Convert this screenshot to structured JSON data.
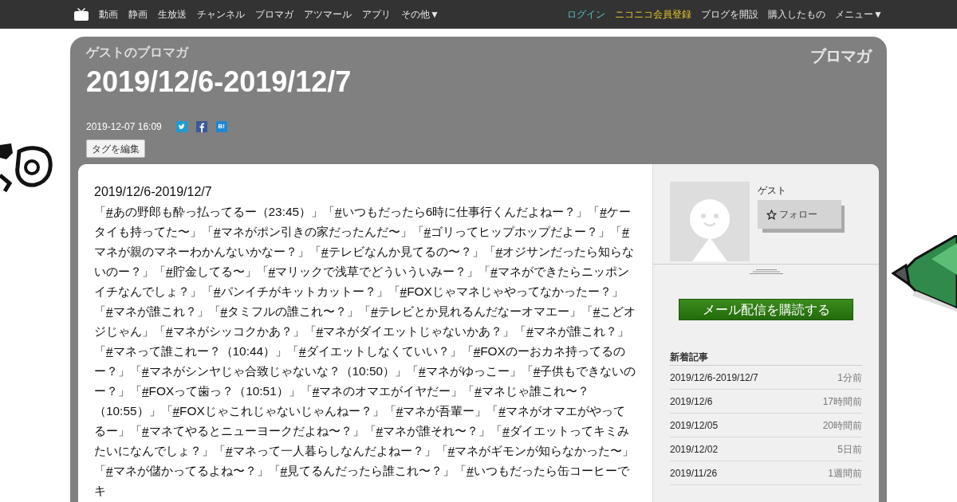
{
  "top_bar": {
    "nav": [
      "動画",
      "静画",
      "生放送",
      "チャンネル",
      "ブロマガ",
      "アツマール",
      "アプリ",
      "その他▼"
    ],
    "account": [
      {
        "label": "ログイン",
        "kind": "login"
      },
      {
        "label": "ニコニコ会員登録",
        "kind": "register"
      },
      {
        "label": "ブログを開設",
        "kind": "plain"
      },
      {
        "label": "購入したもの",
        "kind": "plain"
      },
      {
        "label": "メニュー▼",
        "kind": "plain"
      }
    ]
  },
  "header": {
    "blog_name": "ゲストのブロマガ",
    "logo": "ブロマガ",
    "title": "2019/12/6-2019/12/7",
    "date": "2019-12-07 16:09",
    "share": [
      {
        "kind": "twitter"
      },
      {
        "kind": "facebook"
      },
      {
        "kind": "hatena",
        "label": "B!"
      }
    ],
    "tag_button": "タグを編集"
  },
  "article": {
    "heading": "2019/12/6-2019/12/7",
    "tags": [
      {
        "open": "「",
        "link": "#",
        "rest": "あの野郎も酔っ払ってるー（23:45）」"
      },
      {
        "open": "「",
        "link": "#",
        "rest": "いつもだったら6時に仕事行くんだよねー？」"
      },
      {
        "open": "「",
        "link": "#",
        "rest": "ケータイも持ってた〜」"
      },
      {
        "open": "「",
        "link": "#",
        "rest": "マネがポン引きの家だったんだ〜」"
      },
      {
        "open": "「",
        "link": "#",
        "rest": "ゴリってヒップホップだよー？」"
      },
      {
        "open": "「",
        "link": "#",
        "rest": "マネが親のマネーわかんないかなー？」"
      },
      {
        "open": "「",
        "link": "#",
        "rest": "テレビなんか見てるの〜？」"
      },
      {
        "open": "「",
        "link": "#",
        "rest": "オジサンだったら知らないのー？」"
      },
      {
        "open": "「",
        "link": "#",
        "rest": "貯金してる〜」"
      },
      {
        "open": "「",
        "link": "#",
        "rest": "マリックで浅草でどういういみー？」"
      },
      {
        "open": "「",
        "link": "#",
        "rest": "マネができたらニッポンイチなんでしょ？」"
      },
      {
        "open": "「",
        "link": "#",
        "rest": "パンイチがキットカットー？」"
      },
      {
        "open": "「",
        "link": "#",
        "rest": "FOXじゃマネじゃやってなかったー？」"
      },
      {
        "open": "「",
        "link": "#",
        "rest": "マネが誰これ？」"
      },
      {
        "open": "「",
        "link": "#",
        "rest": "タミフルの誰これ〜？」"
      },
      {
        "open": "「",
        "link": "#",
        "rest": "テレビとか見れるんだなーオマエー」"
      },
      {
        "open": "「",
        "link": "#",
        "rest": "こどオジじゃん」"
      },
      {
        "open": "「",
        "link": "#",
        "rest": "マネがシッコクかあ？」"
      },
      {
        "open": "「",
        "link": "#",
        "rest": "マネがダイエットじゃないかあ？」"
      },
      {
        "open": "「",
        "link": "#",
        "rest": "マネが誰これ？」"
      },
      {
        "open": "「",
        "link": "#",
        "rest": "マネって誰これー？（10:44）」"
      },
      {
        "open": "「",
        "link": "#",
        "rest": "ダイエットしなくていい？」"
      },
      {
        "open": "「",
        "link": "#",
        "rest": "FOXのーおカネ持ってるのー？」"
      },
      {
        "open": "「",
        "link": "#",
        "rest": "マネがシンヤじゃ合致じゃないな？（10:50）」"
      },
      {
        "open": "「",
        "link": "#",
        "rest": "マネがゆっこー」"
      },
      {
        "open": "「",
        "link": "#",
        "rest": "子供もできないのー？」"
      },
      {
        "open": "「",
        "link": "#",
        "rest": "FOXって歯っ？（10:51）」"
      },
      {
        "open": "「",
        "link": "#",
        "rest": "マネのオマエがイヤだー」"
      },
      {
        "open": "「",
        "link": "#",
        "rest": "マネじゃ誰これ〜？（10:55）」"
      },
      {
        "open": "「",
        "link": "#",
        "rest": "FOXじゃこれじゃないじゃんねー？」"
      },
      {
        "open": "「",
        "link": "#",
        "rest": "マネが吾輩ー」"
      },
      {
        "open": "「",
        "link": "#",
        "rest": "マネがオマエがやってるー」"
      },
      {
        "open": "「",
        "link": "#",
        "rest": "マネてやるとニューヨークだよね〜？」"
      },
      {
        "open": "「",
        "link": "#",
        "rest": "マネが誰それ〜？」"
      },
      {
        "open": "「",
        "link": "#",
        "rest": "ダイエットってキミみたいになんでしょ？」"
      },
      {
        "open": "「",
        "link": "#",
        "rest": "マネって一人暮らしなんだよねー？」"
      },
      {
        "open": "「",
        "link": "#",
        "rest": "マネがギモンが知らなかった〜」"
      },
      {
        "open": "「",
        "link": "#",
        "rest": "マネが儲かってるよね〜？」"
      },
      {
        "open": "「",
        "link": "#",
        "rest": "見てるんだったら誰これ〜？」"
      },
      {
        "open": "「",
        "link": "#",
        "rest": "いつもだったら缶コーヒーでキ"
      }
    ]
  },
  "sidebar": {
    "author": "ゲスト",
    "follow_button": "フォロー",
    "subscribe_button": "メール配信を購読する",
    "recent_title": "新着記事",
    "recent": [
      {
        "title": "2019/12/6-2019/12/7",
        "ago": "1分前"
      },
      {
        "title": "2019/12/6",
        "ago": "17時間前"
      },
      {
        "title": "2019/12/05",
        "ago": "20時間前"
      },
      {
        "title": "2019/12/02",
        "ago": "5日前"
      },
      {
        "title": "2019/11/26",
        "ago": "1週間前"
      }
    ]
  }
}
